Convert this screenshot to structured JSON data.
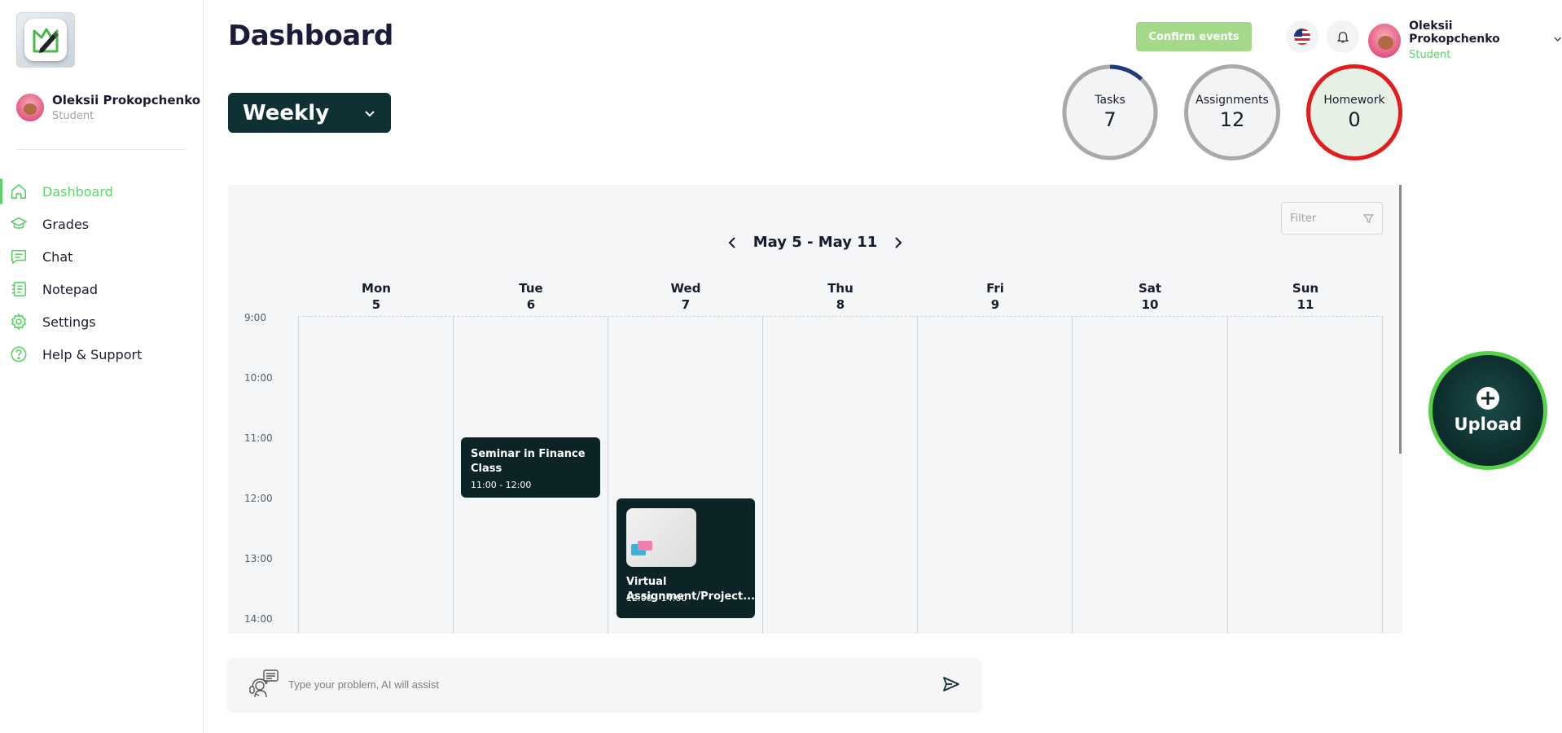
{
  "sidebar": {
    "user": {
      "name": "Oleksii Prokopchenko",
      "role": "Student"
    },
    "items": [
      {
        "label": "Dashboard",
        "icon": "home-icon",
        "active": true
      },
      {
        "label": "Grades",
        "icon": "graduation-cap-icon"
      },
      {
        "label": "Chat",
        "icon": "chat-icon"
      },
      {
        "label": "Notepad",
        "icon": "notepad-icon"
      },
      {
        "label": "Settings",
        "icon": "gear-icon"
      },
      {
        "label": "Help & Support",
        "icon": "help-icon"
      }
    ]
  },
  "header": {
    "title": "Dashboard",
    "confirm_label": "Confirm events",
    "user": {
      "name": "Oleksii Prokopchenko",
      "role": "Student"
    }
  },
  "view_select": {
    "selected": "Weekly"
  },
  "stats": [
    {
      "label": "Tasks",
      "value": "7",
      "progress": 0.12
    },
    {
      "label": "Assignments",
      "value": "12"
    },
    {
      "label": "Homework",
      "value": "0"
    }
  ],
  "calendar": {
    "range": "May 5 - May 11",
    "filter_placeholder": "Filter",
    "days": [
      {
        "name": "Mon",
        "date": "5"
      },
      {
        "name": "Tue",
        "date": "6"
      },
      {
        "name": "Wed",
        "date": "7"
      },
      {
        "name": "Thu",
        "date": "8"
      },
      {
        "name": "Fri",
        "date": "9"
      },
      {
        "name": "Sat",
        "date": "10"
      },
      {
        "name": "Sun",
        "date": "11"
      }
    ],
    "times": [
      "9:00",
      "10:00",
      "11:00",
      "12:00",
      "13:00",
      "14:00"
    ],
    "events": [
      {
        "title": "Seminar in Finance Class",
        "time": "11:00 - 12:00"
      },
      {
        "title": "Virtual Assignment/Project...",
        "time": "12:00 - 14:00"
      }
    ]
  },
  "upload": {
    "label": "Upload"
  },
  "ai": {
    "placeholder": "Type your problem, AI will assist"
  },
  "colors": {
    "accent": "#5ed16a",
    "dark": "#0f3133",
    "alert": "#e11d1d",
    "confirm": "#a4d98a"
  }
}
